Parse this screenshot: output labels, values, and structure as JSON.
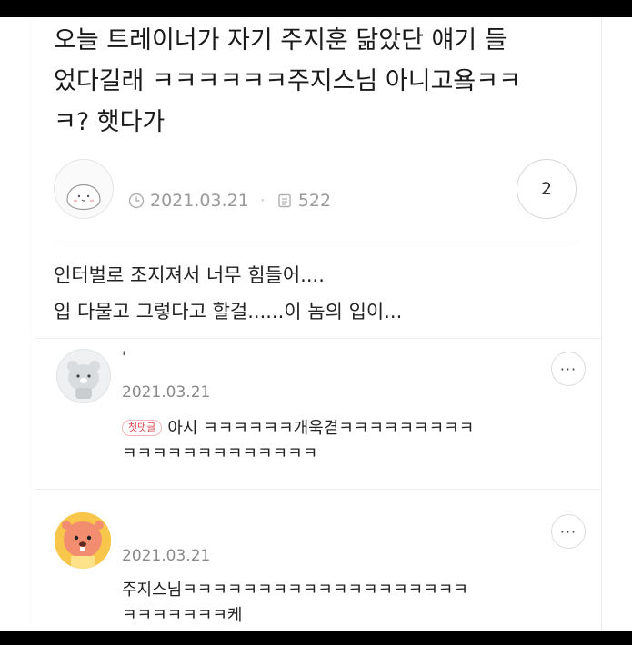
{
  "post": {
    "title_line1": "오늘 트레이너가 자기 주지훈 닮았단 얘기 들",
    "title_line2": "었다길래 ㅋㅋㅋㅋㅋㅋ주지스님 아니고욬ㅋㅋ",
    "title_line3": "ㅋ? 햇다가",
    "date": "2021.03.21",
    "views": "522",
    "comment_count": "2",
    "body_line1": "인터벌로 조지져서 너무 힘들어....",
    "body_line2": "입 다물고 그렇다고 할걸......이 놈의 입이..."
  },
  "comments": [
    {
      "author": "'",
      "date": "2021.03.21",
      "badge": "첫댓글",
      "text_line1": "아시 ㅋㅋㅋㅋㅋㅋ개욱겯ㅋㅋㅋㅋㅋㅋㅋㅋㅋ",
      "text_line2": "ㅋㅋㅋㅋㅋㅋㅋㅋㅋㅋㅋㅋㅋ",
      "more_label": "···"
    },
    {
      "date": "2021.03.21",
      "text_line1": "주지스님ㅋㅋㅋㅋㅋㅋㅋㅋㅋㅋㅋㅋㅋㅋㅋㅋㅋㅋㅋ",
      "text_line2": "ㅋㅋㅋㅋㅋㅋㅋ케",
      "more_label": "···"
    }
  ],
  "icons": {
    "clock": "clock-icon",
    "views": "document-icon",
    "more": "more-icon"
  },
  "colors": {
    "badge": "#e0474c",
    "meta_text": "#9a9a9a",
    "frame_bar": "#000000"
  }
}
